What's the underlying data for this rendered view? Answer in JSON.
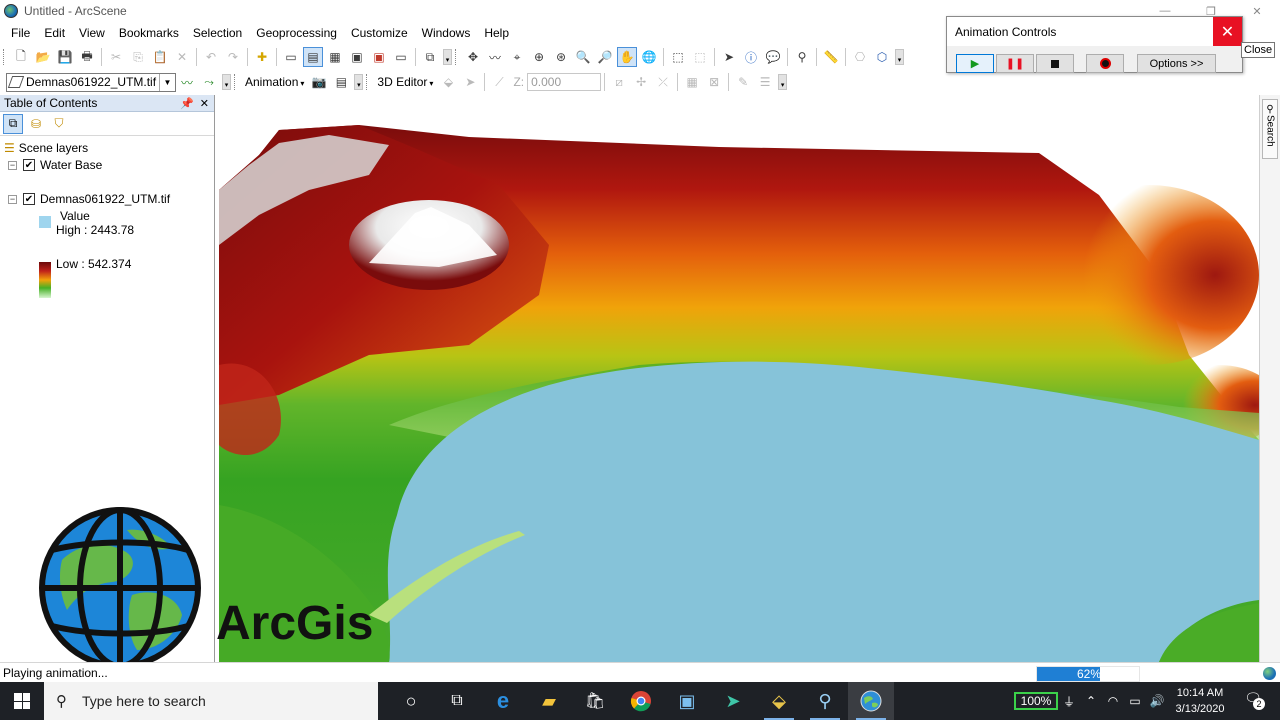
{
  "window": {
    "title": "Untitled - ArcScene"
  },
  "menu": [
    "File",
    "Edit",
    "View",
    "Bookmarks",
    "Selection",
    "Geoprocessing",
    "Customize",
    "Windows",
    "Help"
  ],
  "toolbar2": {
    "layer_select": "Demnas061922_UTM.tif",
    "animation_label": "Animation",
    "editor_label": "3D Editor",
    "z_label": "Z:",
    "z_value": "0.000"
  },
  "toc": {
    "title": "Table of Contents",
    "group_label": "Scene layers",
    "layer1": "Water Base",
    "layer2": "Demnas061922_UTM.tif",
    "value_label": "Value",
    "high": "High : 2443.78",
    "low": "Low : 542.374"
  },
  "search_tab": "Search",
  "logo_text": "ArcGis",
  "status": {
    "text": "Playing animation...",
    "progress_label": "62%",
    "progress_value": 62
  },
  "animation_controls": {
    "title": "Animation Controls",
    "options_label": "Options >>",
    "close_tooltip": "Close"
  },
  "taskbar": {
    "search_placeholder": "Type here to search",
    "battery": "100%",
    "time": "10:14 AM",
    "date": "3/13/2020",
    "notifications": "2"
  },
  "colors": {
    "water": "#86c3d9",
    "terrain_high": "#7a0c0c",
    "terrain_mid": "#f0a30a",
    "terrain_low": "#44ad22",
    "accent": "#1f7fd4",
    "close_red": "#e81123"
  }
}
